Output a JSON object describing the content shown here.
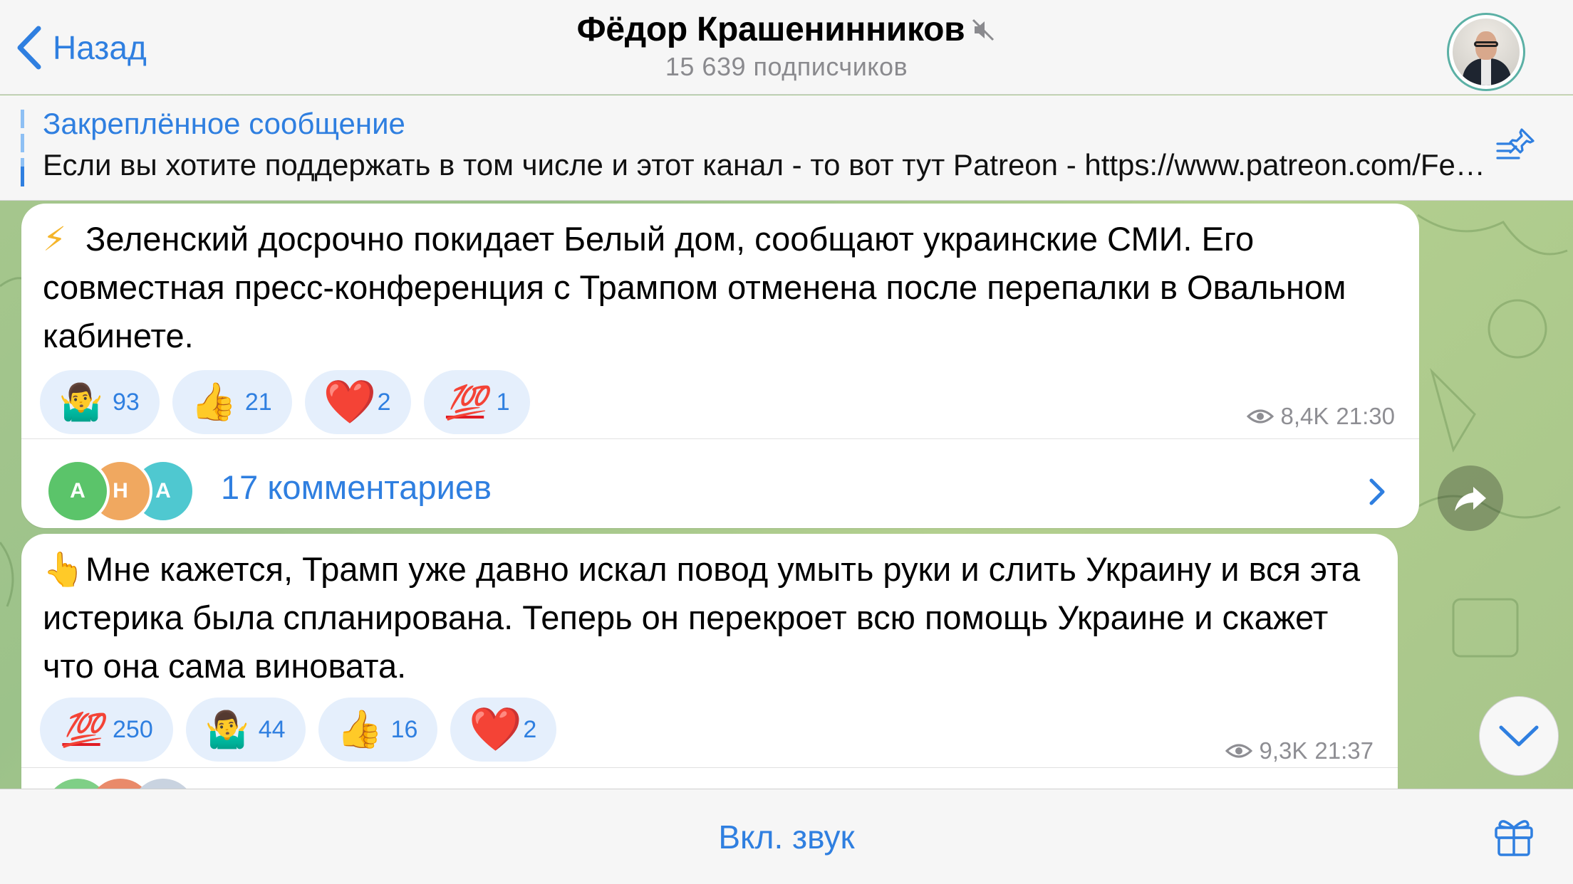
{
  "header": {
    "back_label": "Назад",
    "channel_name": "Фёдор Крашенинников",
    "subscribers": "15 639 подписчиков",
    "muted": true
  },
  "pinned": {
    "title": "Закреплённое сообщение",
    "text": "Если вы хотите поддержать в том числе и этот канал - то вот тут Patreon - https://www.patreon.com/FedorKrasheninnikov"
  },
  "messages": [
    {
      "lead_emoji": "⚡",
      "text": "Зеленский досрочно покидает Белый дом, сообщают украинские СМИ. Его совместная пресс-конференция с Трампом отменена после перепалки в Овальном кабинете.",
      "reactions": [
        {
          "emoji": "🤷‍♂️",
          "count": "93"
        },
        {
          "emoji": "👍",
          "count": "21"
        },
        {
          "emoji": "❤️",
          "count": "2"
        },
        {
          "emoji": "💯",
          "count": "1"
        }
      ],
      "views": "8,4K",
      "time": "21:30",
      "comments": {
        "label": "17 комментариев",
        "avatars": [
          "A",
          "H",
          "A"
        ]
      }
    },
    {
      "lead_emoji": "👆",
      "text": "Мне кажется, Трамп уже давно искал повод умыть руки и слить Украину и вся эта истерика была спланирована. Теперь он перекроет всю помощь Украине и скажет что она сама виновата.",
      "reactions": [
        {
          "emoji": "💯",
          "count": "250"
        },
        {
          "emoji": "🤷‍♂️",
          "count": "44"
        },
        {
          "emoji": "👍",
          "count": "16"
        },
        {
          "emoji": "❤️",
          "count": "2"
        }
      ],
      "views": "9,3K",
      "time": "21:37"
    }
  ],
  "footer": {
    "unmute_label": "Вкл. звук"
  },
  "colors": {
    "accent": "#2f7fe0",
    "reaction_bg": "#e5effc",
    "chat_bg": "#a9c88e"
  },
  "icons": {
    "back": "chevron-left-icon",
    "mute": "speaker-muted-icon",
    "pin_list": "pinned-list-icon",
    "views": "eye-icon",
    "share": "share-arrow-icon",
    "scroll_down": "chevron-down-icon",
    "gift": "gift-icon"
  }
}
